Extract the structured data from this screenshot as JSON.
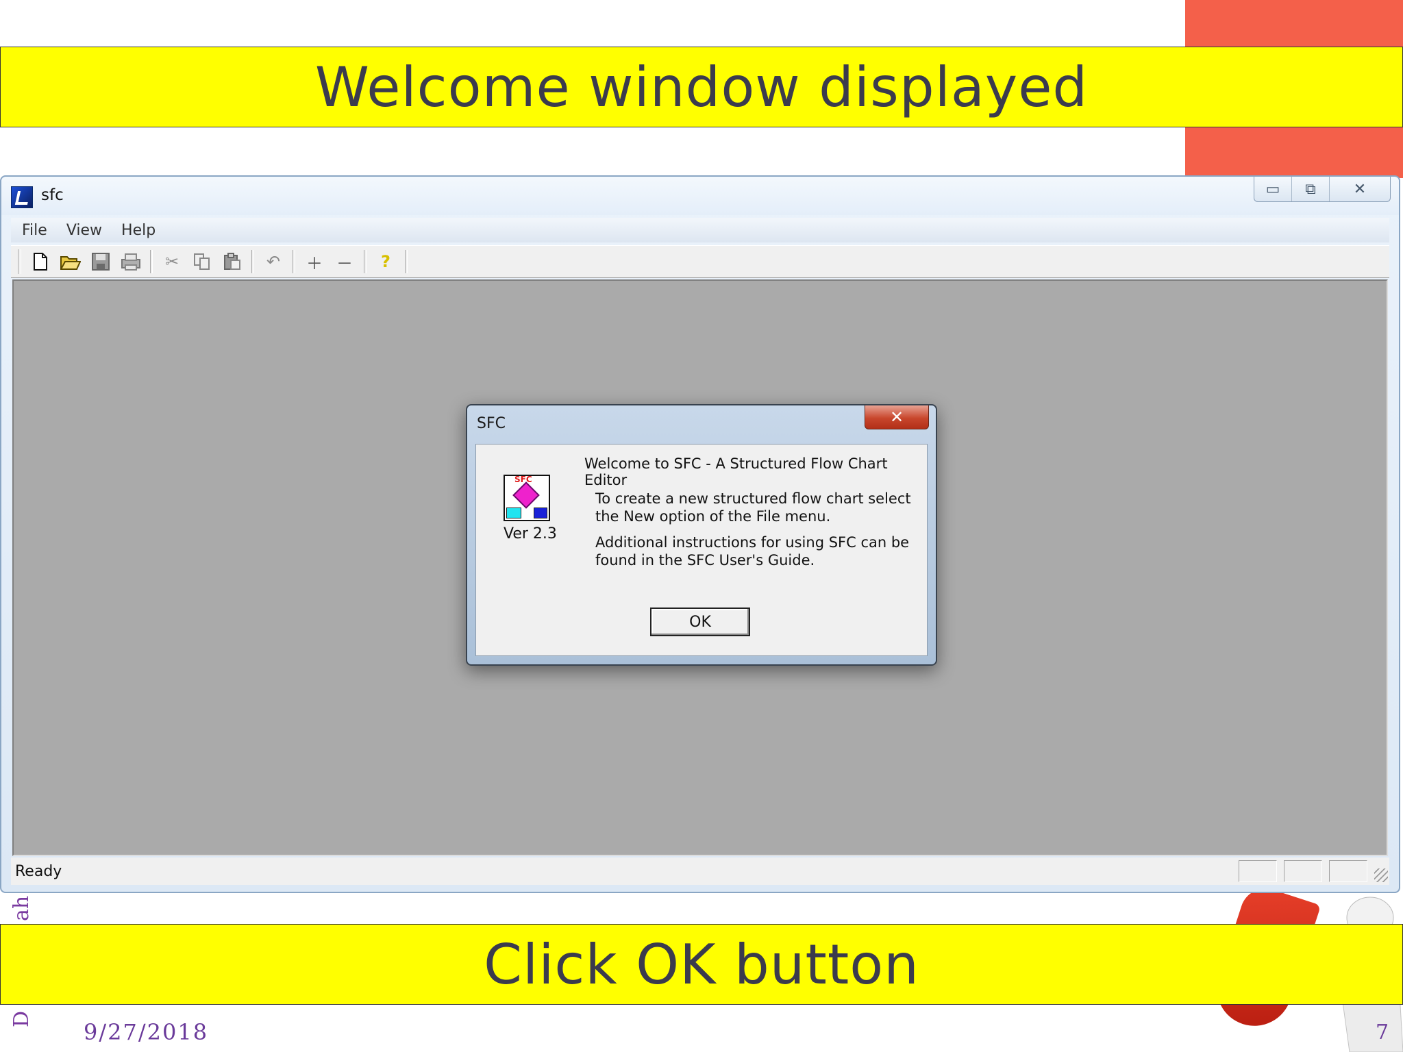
{
  "slide": {
    "top_banner": "Welcome window displayed",
    "bottom_banner": "Click OK button",
    "date": "9/27/2018",
    "page_number": "7",
    "side_text_1": "ah",
    "side_text_2": "D"
  },
  "window": {
    "title": "sfc",
    "caption_buttons": {
      "minimize": "▭",
      "restore": "⧉",
      "close": "✕"
    },
    "menu": [
      "File",
      "View",
      "Help"
    ],
    "toolbar_icons": [
      "new-icon",
      "open-icon",
      "save-icon",
      "print-icon",
      "cut-icon",
      "copy-icon",
      "paste-icon",
      "undo-icon",
      "zoom-in-icon",
      "zoom-out-icon",
      "help-icon"
    ],
    "status": "Ready"
  },
  "dialog": {
    "title": "SFC",
    "close": "✕",
    "logo_text": "SFC",
    "version": "Ver 2.3",
    "heading": "Welcome to SFC - A Structured Flow Chart Editor",
    "paragraph1": "To create a new structured flow chart select the New option of the File menu.",
    "paragraph2": "Additional instructions for using SFC can be found in the SFC User's Guide.",
    "ok_label": "OK"
  },
  "colors": {
    "banner": "#ffff00",
    "banner_text": "#3b3b4d",
    "client_area": "#aaaaaa",
    "accent_red": "#f4604a"
  }
}
